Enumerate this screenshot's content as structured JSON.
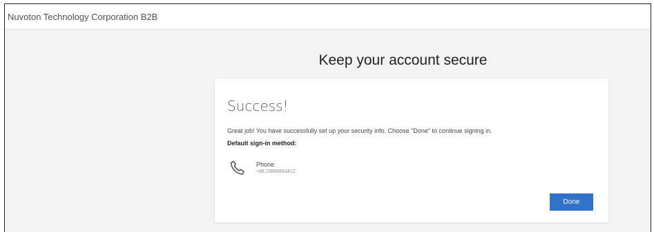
{
  "org_name": "Nuvoton Technology Corporation B2B",
  "page_heading": "Keep your account secure",
  "card": {
    "title": "Success!",
    "message": "Great job! You have successfully set up your security info. Choose \"Done\" to continue signing in.",
    "default_label": "Default sign-in method:",
    "method": {
      "icon": "phone-icon",
      "name": "Phone",
      "number": "+86 15866653412"
    },
    "done_label": "Done"
  },
  "colors": {
    "accent": "#2f72c8",
    "background": "#f3f3f3"
  }
}
